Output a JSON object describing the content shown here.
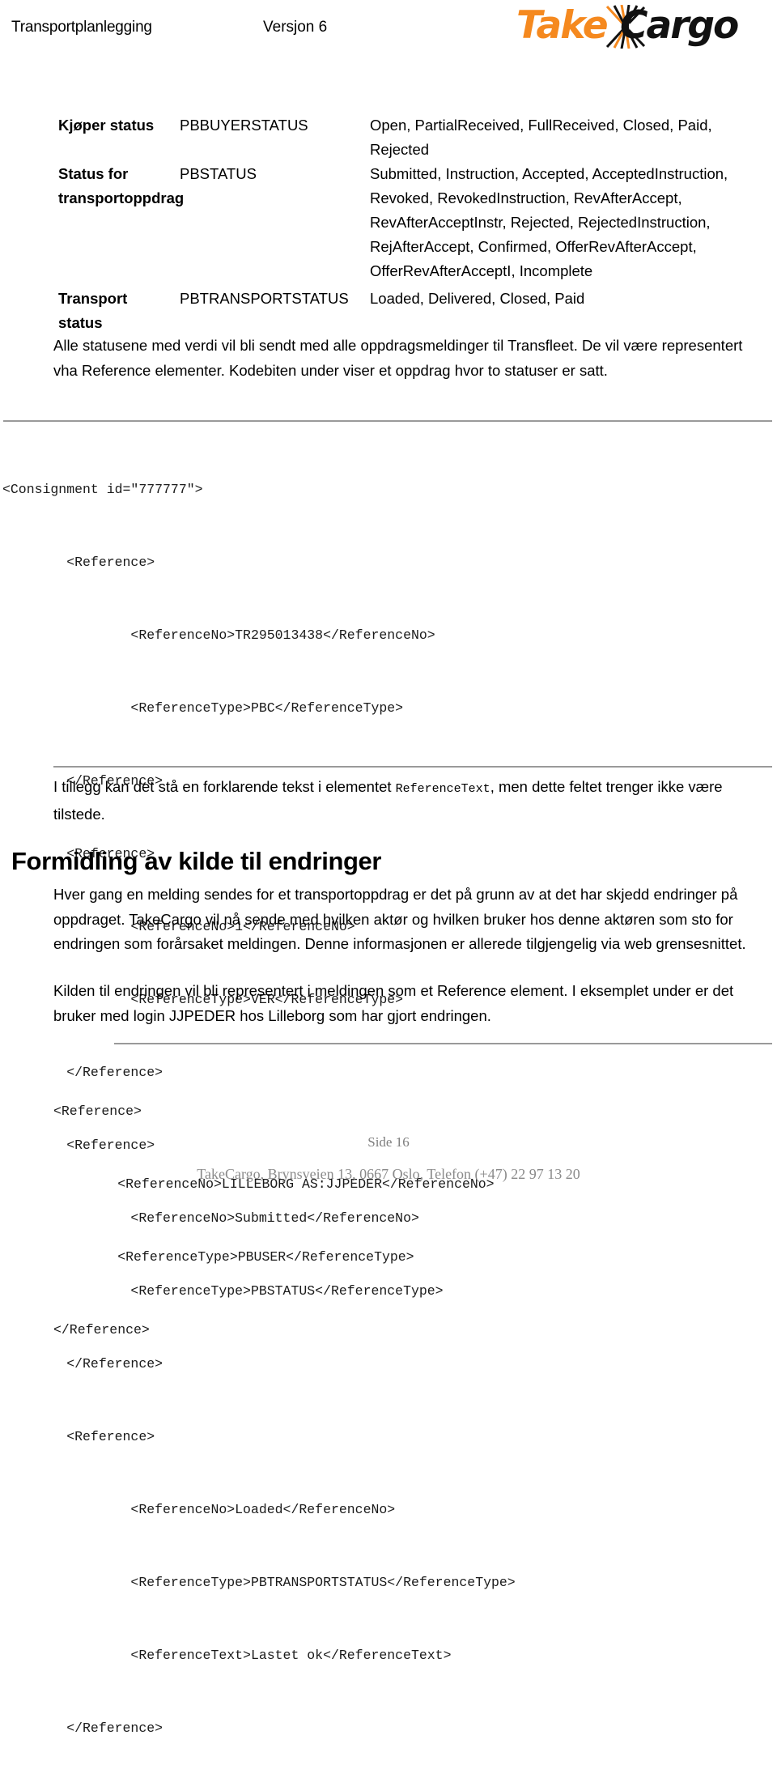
{
  "header": {
    "doc_title": "Transportplanlegging",
    "version": "Versjon 6",
    "logo": {
      "take_text": "Take",
      "cargo_text": "Cargo",
      "orange": "#F5891F",
      "black": "#111111"
    }
  },
  "status_table": {
    "rows": [
      {
        "term": "Kjøper status",
        "code": "PBBUYERSTATUS",
        "values": "Open, PartialReceived, FullReceived, Closed, Paid, Rejected"
      },
      {
        "term": "Status for transportoppdrag",
        "code": "PBSTATUS",
        "values": "Submitted, Instruction, Accepted, AcceptedInstruction, Revoked, RevokedInstruction, RevAfterAccept, RevAfterAcceptInstr, Rejected, RejectedInstruction, RejAfterAccept, Confirmed, OfferRevAfterAccept, OfferRevAfterAcceptI, Incomplete"
      },
      {
        "term": "Transport status",
        "code": "PBTRANSPORTSTATUS",
        "values": "Loaded, Delivered, Closed, Paid"
      }
    ]
  },
  "paragraphs": {
    "intro": "Alle statusene med verdi vil bli sendt med alle oppdragsmeldinger til Transfleet.  De vil være representert vha Reference elementer.  Kodebiten under viser et oppdrag hvor to statuser er satt.",
    "after_code_part1": "I tillegg kan det stå en forklarende tekst i elementet ",
    "after_code_mono": "ReferenceText",
    "after_code_part2": ", men dette feltet trenger ikke være tilstede.",
    "endringer_p1": "Hver gang en melding sendes for et transportoppdrag er det på grunn av at det har skjedd endringer på oppdraget.  TakeCargo vil nå sende med hvilken aktør og hvilken bruker hos denne aktøren som sto for endringen som forårsaket meldingen.  Denne informasjonen er allerede tilgjengelig via web grensesnittet.",
    "endringer_p2": "Kilden til endringen vil bli representert i meldingen som et Reference element.  I eksemplet under er det bruker med login JJPEDER hos Lilleborg som har gjort endringen."
  },
  "section": {
    "heading": "Formidling av kilde til endringer"
  },
  "code_block_1": {
    "lines": [
      "<Consignment id=\"777777\">",
      "        <Reference>",
      "                <ReferenceNo>TR295013438</ReferenceNo>",
      "                <ReferenceType>PBC</ReferenceType>",
      "        </Reference>",
      "        <Reference>",
      "                <ReferenceNo>1</ReferenceNo>",
      "                <ReferenceType>VER</ReferenceType>",
      "        </Reference>",
      "        <Reference>",
      "                <ReferenceNo>Submitted</ReferenceNo>",
      "                <ReferenceType>PBSTATUS</ReferenceType>",
      "        </Reference>",
      "        <Reference>",
      "                <ReferenceNo>Loaded</ReferenceNo>",
      "                <ReferenceType>PBTRANSPORTSTATUS</ReferenceType>",
      "                <ReferenceText>Lastet ok</ReferenceText>",
      "        </Reference>"
    ]
  },
  "code_block_2": {
    "lines": [
      "<Reference>",
      "        <ReferenceNo>LILLEBORG AS:JJPEDER</ReferenceNo>",
      "        <ReferenceType>PBUSER</ReferenceType>",
      "</Reference>"
    ]
  },
  "footer": {
    "page_label": "Side 16",
    "address": "TakeCargo, Brynsveien 13, 0667 Oslo, Telefon (+47)  22 97 13 20"
  }
}
